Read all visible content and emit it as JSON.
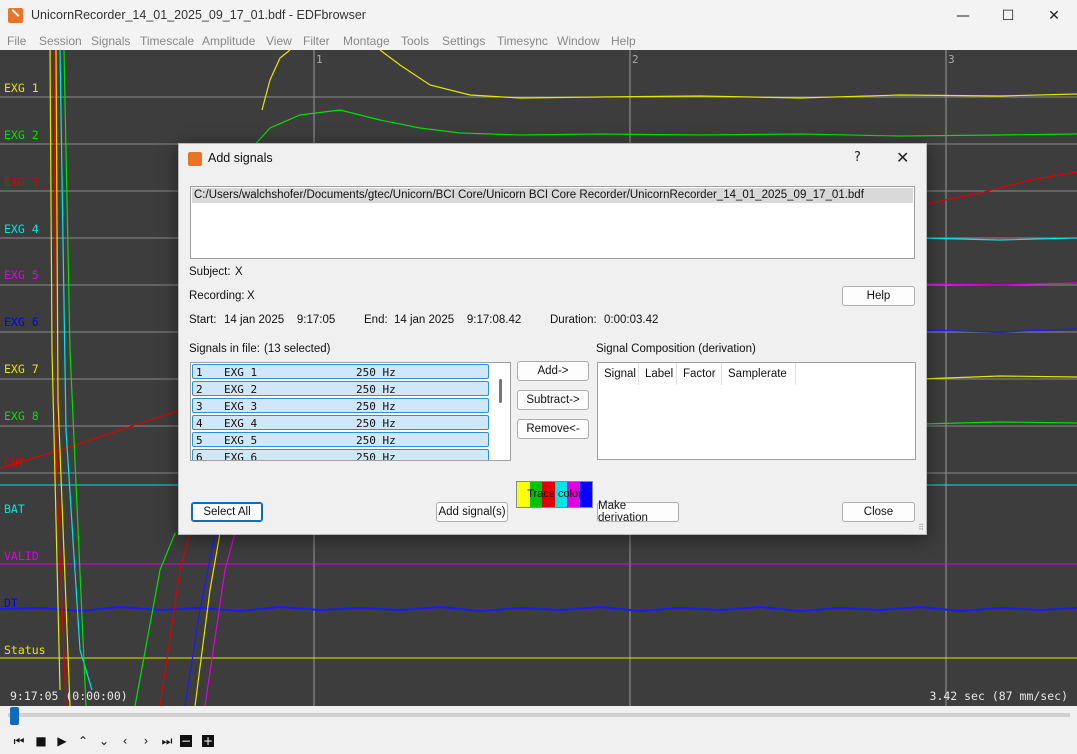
{
  "window": {
    "title": "UnicornRecorder_14_01_2025_09_17_01.bdf - EDFbrowser",
    "minimize": "—",
    "maximize": "☐",
    "close": "✕"
  },
  "menu": [
    "File",
    "Session",
    "Signals",
    "Timescale",
    "Amplitude",
    "View",
    "Filter",
    "Montage",
    "Tools",
    "Settings",
    "Timesync",
    "Window",
    "Help"
  ],
  "plot": {
    "signal_labels": [
      {
        "text": "EXG 1",
        "color": "#e6e600"
      },
      {
        "text": "EXG 2",
        "color": "#00e000"
      },
      {
        "text": "EXG 3",
        "color": "#e00000"
      },
      {
        "text": "EXG 4",
        "color": "#00e6e6"
      },
      {
        "text": "EXG 5",
        "color": "#e000e0"
      },
      {
        "text": "EXG 6",
        "color": "#0000ff"
      },
      {
        "text": "EXG 7",
        "color": "#e6e600"
      },
      {
        "text": "EXG 8",
        "color": "#00e000"
      },
      {
        "text": "CNT",
        "color": "#e00000"
      },
      {
        "text": "BAT",
        "color": "#00e6e6"
      },
      {
        "text": "VALID",
        "color": "#e000e0"
      },
      {
        "text": "DT",
        "color": "#0000ff"
      },
      {
        "text": "Status",
        "color": "#e6e600"
      }
    ],
    "seconds_ticks": [
      "1",
      "2",
      "3"
    ],
    "start_time": "9:17:05 (0:00:00)",
    "timescale": "3.42 sec  (87 mm/sec)"
  },
  "dialog": {
    "title": "Add signals",
    "help_glyph": "?",
    "close_glyph": "✕",
    "file_path": "C:/Users/walchshofer/Documents/gtec/Unicorn/BCI Core/Unicorn BCI Core Recorder/UnicornRecorder_14_01_2025_09_17_01.bdf",
    "subject_label": "Subject:",
    "subject_value": "X",
    "recording_label": "Recording:",
    "recording_value": "X",
    "start_label": "Start:",
    "start_value": "14 jan 2025    9:17:05",
    "end_label": "End:",
    "end_value": "14 jan 2025    9:17:08.42",
    "duration_label": "Duration:",
    "duration_value": "0:00:03.42",
    "help_button": "Help",
    "signals_in_file_label": "Signals in file:",
    "selected_count": "(13 selected)",
    "signals": [
      {
        "num": "1",
        "label": "EXG 1",
        "rate": "250 Hz"
      },
      {
        "num": "2",
        "label": "EXG 2",
        "rate": "250 Hz"
      },
      {
        "num": "3",
        "label": "EXG 3",
        "rate": "250 Hz"
      },
      {
        "num": "4",
        "label": "EXG 4",
        "rate": "250 Hz"
      },
      {
        "num": "5",
        "label": "EXG 5",
        "rate": "250 Hz"
      },
      {
        "num": "6",
        "label": "EXG 6",
        "rate": "250 Hz"
      }
    ],
    "add_button": "Add->",
    "subtract_button": "Subtract->",
    "remove_button": "Remove<-",
    "composition_label": "Signal Composition (derivation)",
    "composition_columns": [
      "Signal",
      "Label",
      "Factor",
      "Samplerate"
    ],
    "trace_color_label": "Trace color",
    "trace_colors": [
      "#ffff00",
      "#00c000",
      "#e00000",
      "#00e6e6",
      "#e000e0",
      "#0000ff"
    ],
    "select_all_button": "Select All",
    "add_signals_button": "Add signal(s)",
    "make_derivation_button": "Make derivation",
    "close_button": "Close"
  },
  "controls": [
    "⏮",
    "■",
    "▶",
    "⌃",
    "⌄",
    "‹",
    "›",
    "⏭",
    "−",
    "+"
  ]
}
